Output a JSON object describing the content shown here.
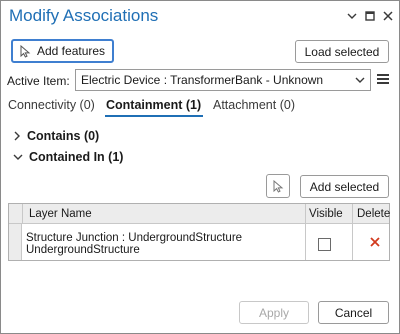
{
  "window": {
    "title": "Modify Associations"
  },
  "toolbar": {
    "add_features_label": "Add features",
    "load_selected_label": "Load selected"
  },
  "active_item": {
    "label": "Active Item:",
    "value": "Electric Device : TransformerBank - Unknown"
  },
  "tabs": [
    {
      "label": "Connectivity (0)",
      "active": false
    },
    {
      "label": "Containment (1)",
      "active": true
    },
    {
      "label": "Attachment (0)",
      "active": false
    }
  ],
  "tree": {
    "contains_label": "Contains (0)",
    "contained_in_label": "Contained In (1)"
  },
  "grid_toolbar": {
    "add_selected_label": "Add selected"
  },
  "table": {
    "columns": [
      "Layer Name",
      "Visible",
      "Delete"
    ],
    "rows": [
      {
        "line1": "Structure Junction : UndergroundStructure",
        "line2": "UndergroundStructure",
        "visible": false
      }
    ]
  },
  "footer": {
    "apply_label": "Apply",
    "cancel_label": "Cancel"
  },
  "colors": {
    "accent": "#1f6fb5",
    "delete": "#d23a1e"
  }
}
